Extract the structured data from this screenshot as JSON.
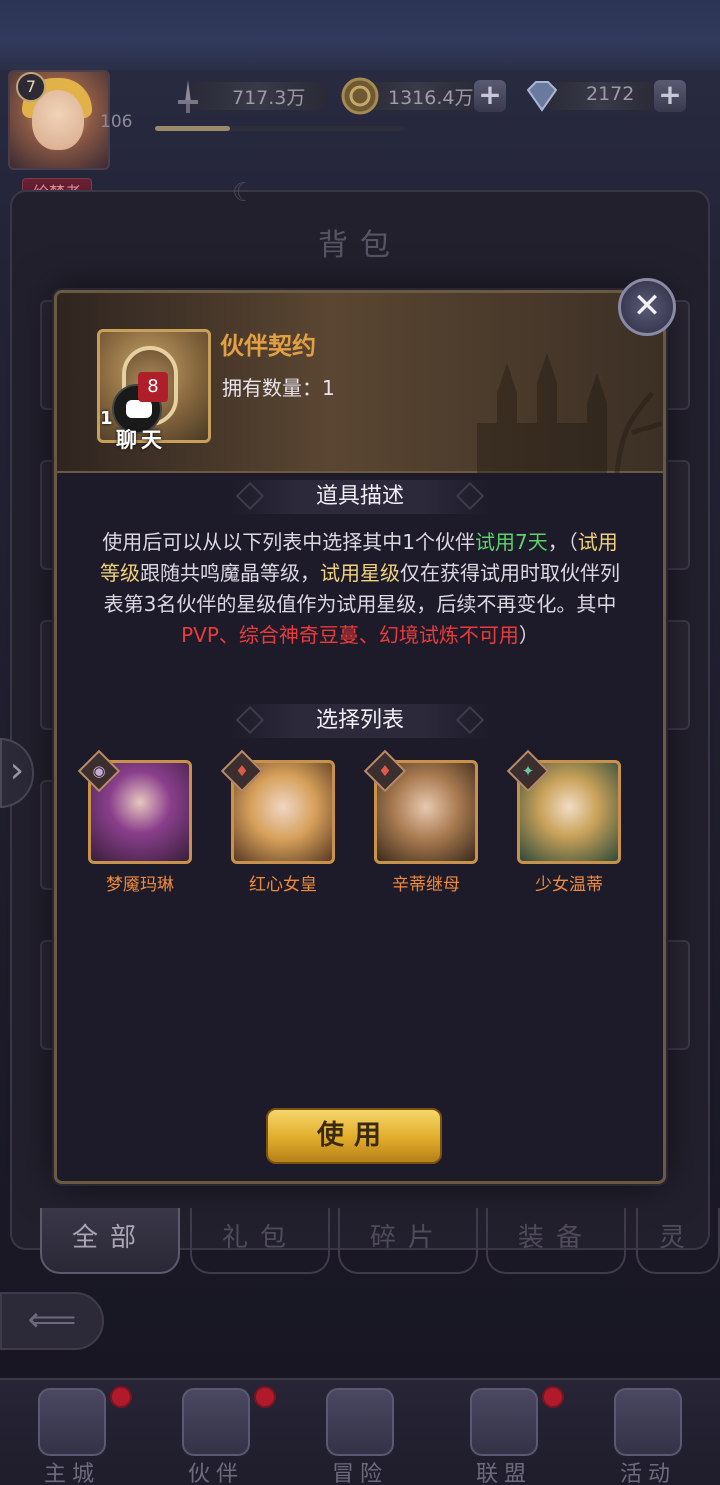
{
  "player": {
    "level": "7",
    "xp": "106",
    "title": "绘梦者"
  },
  "resources": {
    "power": "717.3万",
    "gold": "1316.4万",
    "diamond": "2172"
  },
  "panel": {
    "title": "背包"
  },
  "dialog": {
    "item_name": "伙伴契约",
    "owned_label": "拥有数量：1",
    "item_count": "1",
    "chat_badge": "8",
    "chat_label": "聊天",
    "desc_title": "道具描述",
    "desc": {
      "p1": "使用后可以从以下列表中选择其中1个伙伴",
      "trial": "试用7天",
      "p2": "，（",
      "trial_level": "试用等级",
      "p3": "跟随共鸣魔晶等级，",
      "trial_star": "试用星级",
      "p4": "仅在获得试用时取伙伴列表第3名伙伴的星级值作为试用星级，后续不再变化。其中",
      "restricted": "PVP、综合神奇豆蔓、幻境试炼不可用",
      "p5": "）"
    },
    "list_title": "选择列表",
    "partners": [
      {
        "name": "梦魇玛琳",
        "element": "dark"
      },
      {
        "name": "红心女皇",
        "element": "fire"
      },
      {
        "name": "辛蒂继母",
        "element": "fire"
      },
      {
        "name": "少女温蒂",
        "element": "wind"
      }
    ],
    "use_button": "使用"
  },
  "tabs": [
    "全部",
    "礼包",
    "碎片",
    "装备",
    "灵"
  ],
  "nav": [
    {
      "label": "主城",
      "badge": true
    },
    {
      "label": "伙伴",
      "badge": true
    },
    {
      "label": "冒险",
      "badge": false
    },
    {
      "label": "联盟",
      "badge": true
    },
    {
      "label": "活动",
      "badge": false
    }
  ],
  "colors": {
    "accent_gold": "#e3a043",
    "trial_green": "#5cd36a",
    "warning_red": "#ea3b3b",
    "partner_name": "#ef8a3a"
  }
}
